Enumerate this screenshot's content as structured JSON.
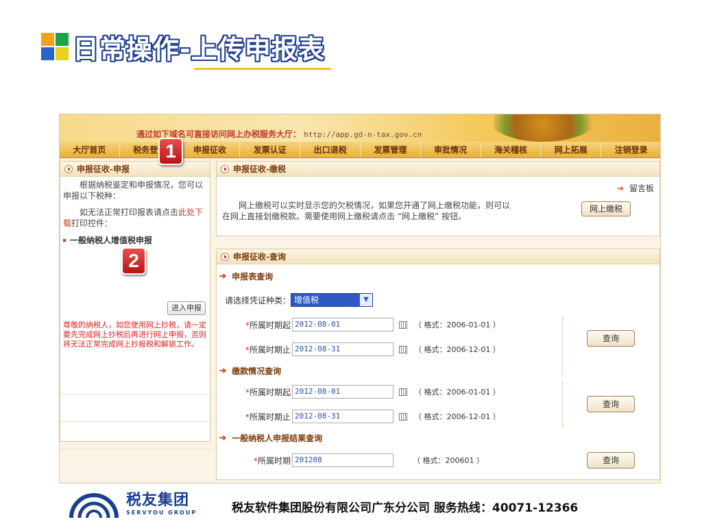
{
  "slide": {
    "title": "日常操作-上传申报表",
    "logo_colors": [
      "#f4a21c",
      "#1ea34a",
      "#2b64c9",
      "#e8d21a"
    ]
  },
  "app": {
    "banner_text": "通过如下域名可直接访问网上办税服务大厅：",
    "banner_url": "http://app.gd-n-tax.gov.cn",
    "nav": [
      "大厅首页",
      "税务登记",
      "申报征收",
      "发票认证",
      "出口退税",
      "发票管理",
      "审批情况",
      "海关稽核",
      "网上拓展",
      "注销登录"
    ],
    "left": {
      "head": "申报征收-申报",
      "p1": "根据纳税鉴定和申报情况，您可以申报以下税种：",
      "p2_prefix": "如无法正常打印报表请点击",
      "p2_link": "此处下载",
      "p2_suffix": "打印控件：",
      "sub": "一般纳税人增值税申报",
      "enter_button": "进入申报",
      "warning": "尊敬的纳税人，如您使用网上抄税，请一定要先完成网上抄税后再进行网上申报，否则将无法正常完成网上抄报税和解锁工作。"
    },
    "pay": {
      "head": "申报征收-缴税",
      "message_board": "留言板",
      "desc_line1": "网上缴税可以实时显示您的欠税情况，如果您开通了网上缴税功能，则可以",
      "desc_line2": "在网上直接划缴税款。需要使用网上缴税请点击 “网上缴税” 按钮。",
      "button": "网上缴税"
    },
    "query": {
      "head": "申报征收-查询",
      "sec1": "申报表查询",
      "voucher_label": "请选择凭证种类：",
      "voucher_value": "增值税",
      "start_label": "所属时期起",
      "end_label": "所属时期止",
      "sec1_start": "2012-08-01",
      "sec1_end": "2012-08-31",
      "fmt_start": "（ 格式：2006-01-01 ）",
      "fmt_end": "（ 格式：2006-12-01 ）",
      "button": "查询",
      "sec2": "缴款情况查询",
      "sec2_start": "2012-08-01",
      "sec2_end": "2012-08-31",
      "sec3": "一般纳税人申报结果查询",
      "period_label": "所属时期",
      "period_value": "201208",
      "fmt_period": "（ 格式：200601 ）"
    },
    "badges": [
      "1",
      "2"
    ]
  },
  "footer": {
    "brand_cn": "税友集团",
    "brand_en": "SERVYOU GROUP",
    "text": "税友软件集团股份有限公司广东分公司   服务热线：40071-12366"
  }
}
